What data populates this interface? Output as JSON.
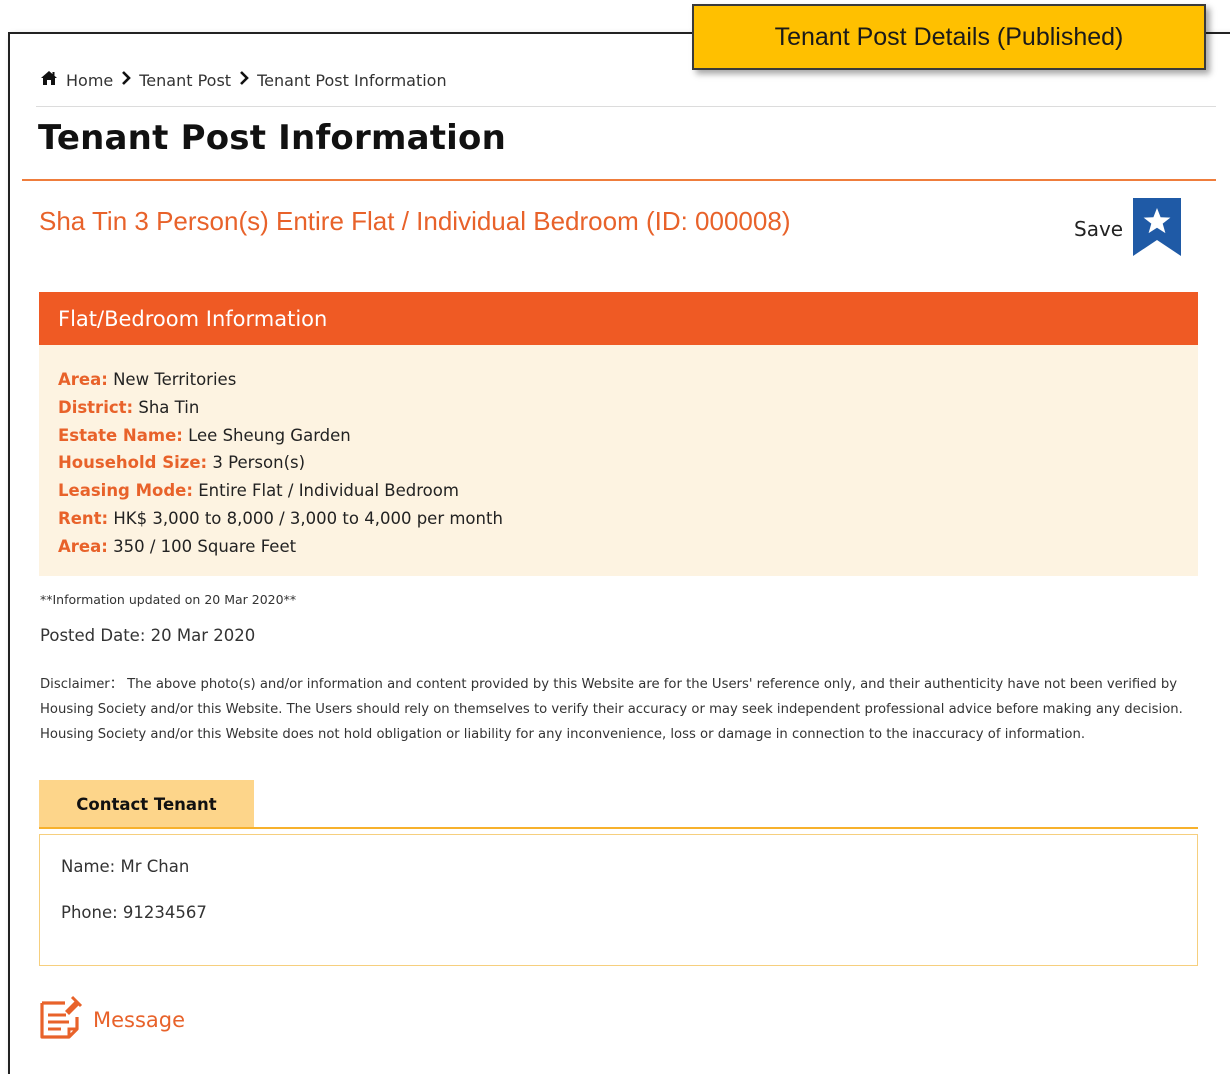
{
  "callout": {
    "label": "Tenant Post Details (Published)"
  },
  "breadcrumb": {
    "items": [
      "Home",
      "Tenant Post",
      "Tenant Post Information"
    ]
  },
  "page_title": "Tenant Post Information",
  "post": {
    "heading": "Sha Tin 3 Person(s) Entire Flat / Individual Bedroom (ID: 000008)",
    "save_label": "Save"
  },
  "info": {
    "header": "Flat/Bedroom Information",
    "rows": [
      {
        "key": "Area:",
        "value": "New Territories"
      },
      {
        "key": "District:",
        "value": "Sha Tin"
      },
      {
        "key": "Estate Name:",
        "value": "Lee Sheung Garden"
      },
      {
        "key": "Household Size:",
        "value": "3 Person(s)"
      },
      {
        "key": "Leasing Mode:",
        "value": "Entire Flat / Individual Bedroom"
      },
      {
        "key": "Rent:",
        "value": "HK$ 3,000 to 8,000 / 3,000 to 4,000 per month"
      },
      {
        "key": "Area:",
        "value": "350 / 100 Square Feet"
      }
    ]
  },
  "updated": "**Information updated on 20 Mar 2020**",
  "posted": "Posted Date: 20 Mar 2020",
  "disclaimer": "Disclaimer： The above photo(s) and/or information and content provided by this Website are for the Users' reference only, and their authenticity have not been verified by Housing Society and/or this Website. The Users should rely on themselves to verify their accuracy or may seek independent professional advice before making any decision. Housing Society and/or this Website does not hold obligation or liability for any inconvenience, loss or damage in connection to the inaccuracy of information.",
  "contact": {
    "tab_label": "Contact Tenant",
    "name": "Name: Mr Chan",
    "phone": "Phone: 91234567"
  },
  "message": {
    "label": "Message"
  },
  "colors": {
    "accent": "#ef5a24",
    "heading": "#e8622a",
    "save_blue": "#1f5aa6",
    "callout": "#ffc000",
    "info_bg": "#fdf3e1",
    "tab_bg": "#fdd58a"
  },
  "icons": [
    "home-icon",
    "chevron-right-icon",
    "bookmark-star-icon",
    "message-note-icon"
  ]
}
